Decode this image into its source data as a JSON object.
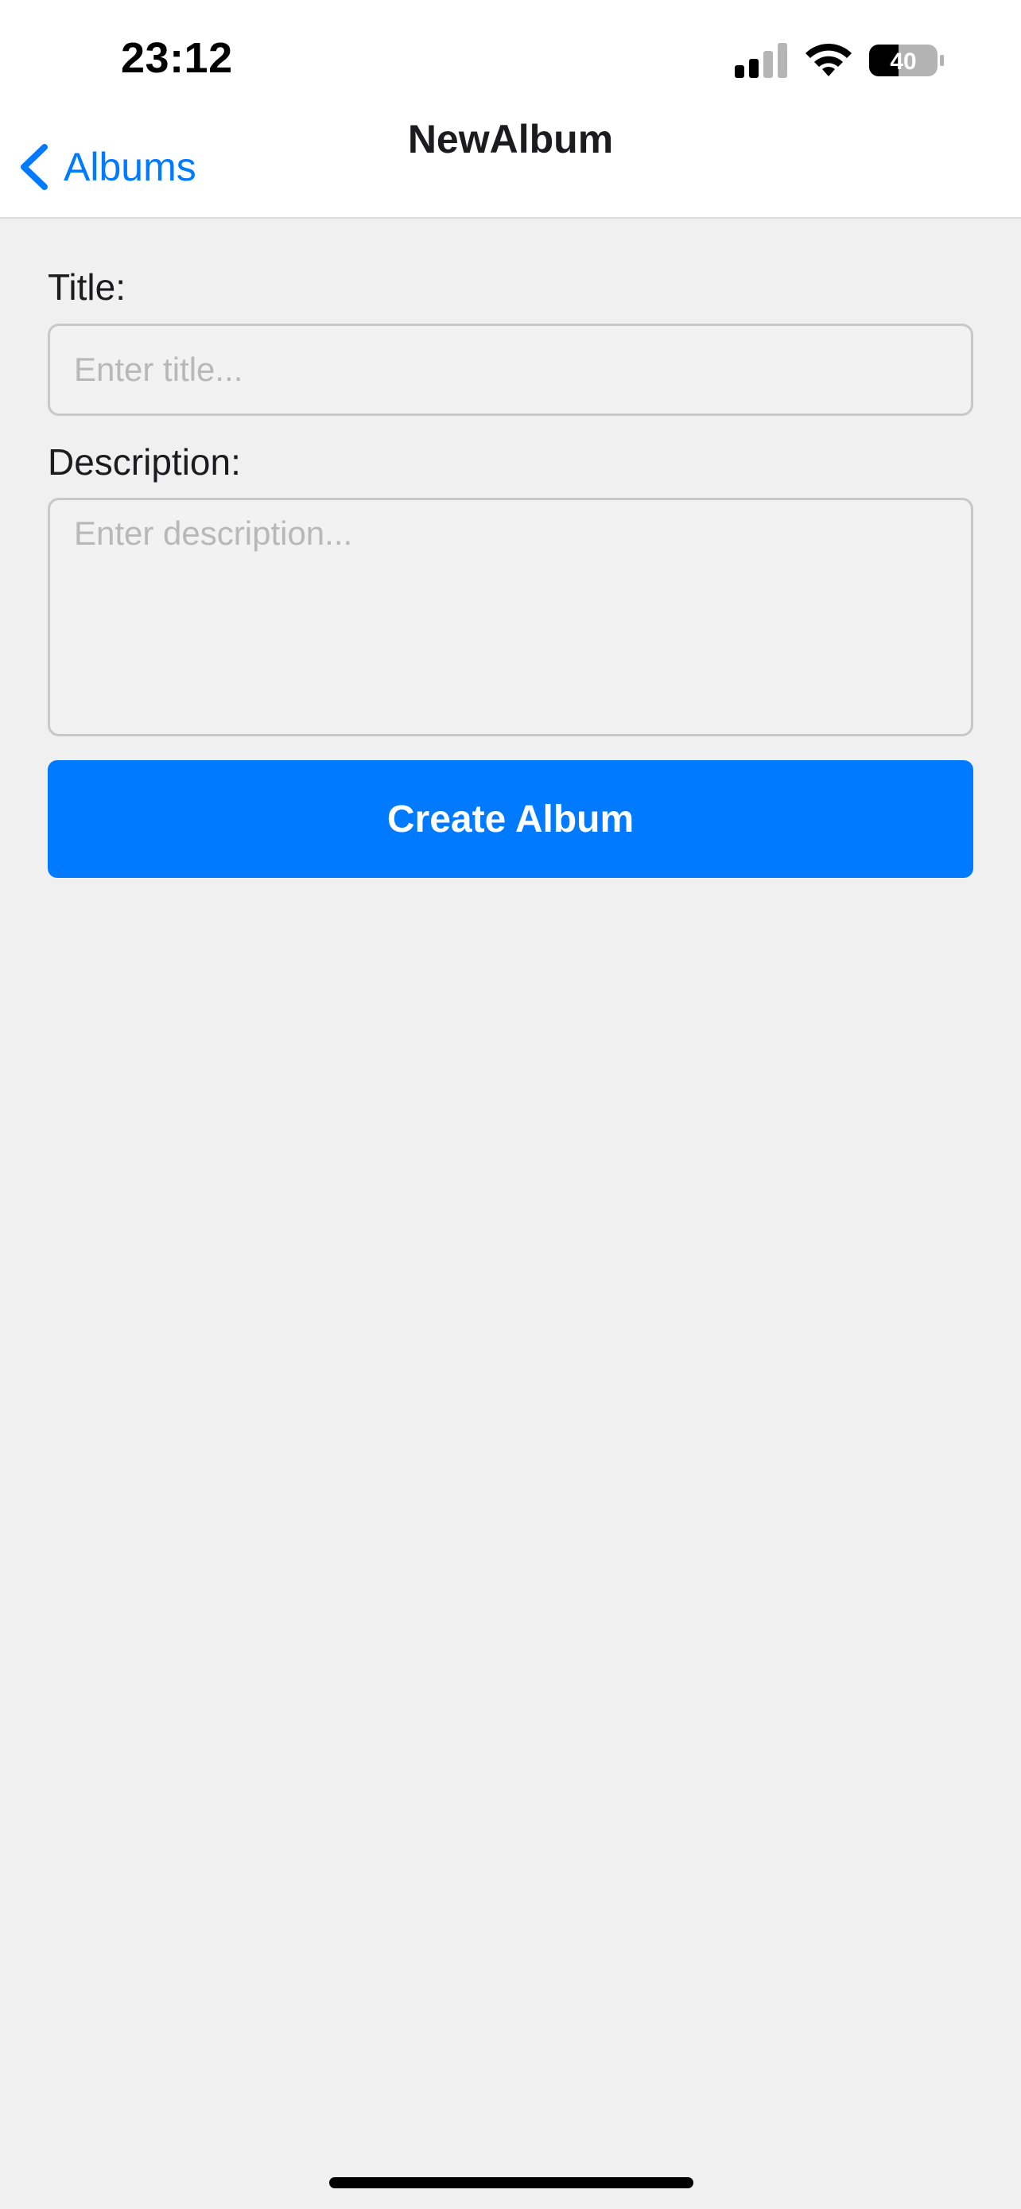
{
  "status_bar": {
    "time": "23:12",
    "battery_level": "40",
    "signal_icon": "cellular-signal-icon",
    "wifi_icon": "wifi-icon",
    "battery_icon": "battery-icon"
  },
  "nav": {
    "back_label": "Albums",
    "back_icon": "chevron-left-icon",
    "title": "NewAlbum"
  },
  "form": {
    "title_label": "Title:",
    "title_placeholder": "Enter title...",
    "title_value": "",
    "description_label": "Description:",
    "description_placeholder": "Enter description...",
    "description_value": "",
    "create_button_label": "Create Album"
  },
  "colors": {
    "accent": "#007aff",
    "background": "#f0f0f0",
    "nav_background": "#ffffff"
  }
}
